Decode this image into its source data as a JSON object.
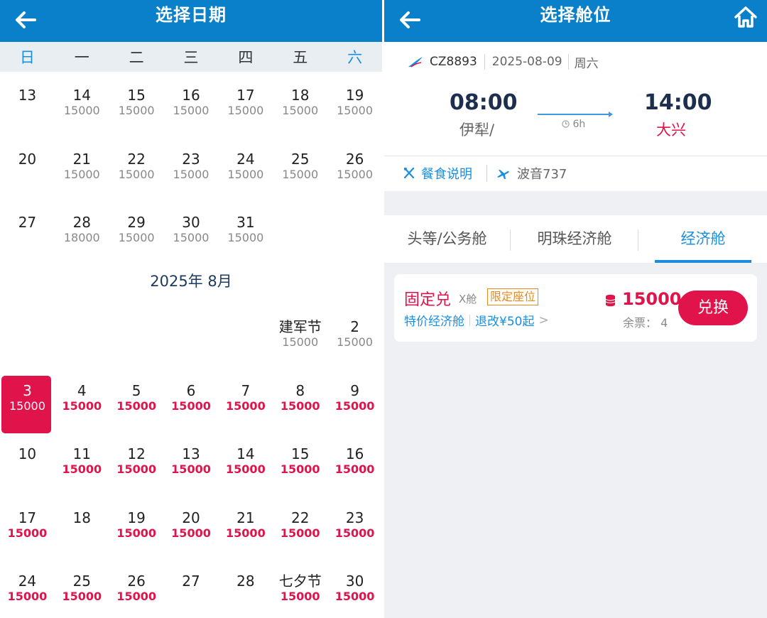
{
  "left": {
    "title": "选择日期",
    "weekdays": [
      "日",
      "一",
      "二",
      "三",
      "四",
      "五",
      "六"
    ],
    "july_rows": [
      [
        {
          "d": "13",
          "p": ""
        },
        {
          "d": "14",
          "p": "15000"
        },
        {
          "d": "15",
          "p": "15000"
        },
        {
          "d": "16",
          "p": "15000"
        },
        {
          "d": "17",
          "p": "15000"
        },
        {
          "d": "18",
          "p": "15000"
        },
        {
          "d": "19",
          "p": "15000"
        }
      ],
      [
        {
          "d": "20",
          "p": ""
        },
        {
          "d": "21",
          "p": "15000"
        },
        {
          "d": "22",
          "p": "15000"
        },
        {
          "d": "23",
          "p": "15000"
        },
        {
          "d": "24",
          "p": "15000"
        },
        {
          "d": "25",
          "p": "15000"
        },
        {
          "d": "26",
          "p": "15000"
        }
      ],
      [
        {
          "d": "27",
          "p": ""
        },
        {
          "d": "28",
          "p": "18000"
        },
        {
          "d": "29",
          "p": "15000"
        },
        {
          "d": "30",
          "p": "15000"
        },
        {
          "d": "31",
          "p": "15000"
        },
        {
          "d": "",
          "p": ""
        },
        {
          "d": "",
          "p": ""
        }
      ]
    ],
    "month_label": "2025年 8月",
    "aug_rows": [
      [
        {
          "d": "",
          "p": ""
        },
        {
          "d": "",
          "p": ""
        },
        {
          "d": "",
          "p": ""
        },
        {
          "d": "",
          "p": ""
        },
        {
          "d": "",
          "p": ""
        },
        {
          "d": "建军节",
          "p": "15000"
        },
        {
          "d": "2",
          "p": "15000"
        }
      ],
      [
        {
          "d": "3",
          "p": "15000",
          "sel": true
        },
        {
          "d": "4",
          "p": "15000",
          "red": true
        },
        {
          "d": "5",
          "p": "15000",
          "red": true
        },
        {
          "d": "6",
          "p": "15000",
          "red": true
        },
        {
          "d": "7",
          "p": "15000",
          "red": true
        },
        {
          "d": "8",
          "p": "15000",
          "red": true
        },
        {
          "d": "9",
          "p": "15000",
          "red": true
        }
      ],
      [
        {
          "d": "10",
          "p": ""
        },
        {
          "d": "11",
          "p": "15000",
          "red": true
        },
        {
          "d": "12",
          "p": "15000",
          "red": true
        },
        {
          "d": "13",
          "p": "15000",
          "red": true
        },
        {
          "d": "14",
          "p": "15000",
          "red": true
        },
        {
          "d": "15",
          "p": "15000",
          "red": true
        },
        {
          "d": "16",
          "p": "15000",
          "red": true
        }
      ],
      [
        {
          "d": "17",
          "p": "15000",
          "red": true
        },
        {
          "d": "18",
          "p": ""
        },
        {
          "d": "19",
          "p": "15000",
          "red": true
        },
        {
          "d": "20",
          "p": "15000",
          "red": true
        },
        {
          "d": "21",
          "p": "15000",
          "red": true
        },
        {
          "d": "22",
          "p": "15000",
          "red": true
        },
        {
          "d": "23",
          "p": "15000",
          "red": true
        }
      ],
      [
        {
          "d": "24",
          "p": "15000",
          "red": true
        },
        {
          "d": "25",
          "p": "15000",
          "red": true
        },
        {
          "d": "26",
          "p": "15000",
          "red": true
        },
        {
          "d": "27",
          "p": ""
        },
        {
          "d": "28",
          "p": ""
        },
        {
          "d": "七夕节",
          "p": "15000",
          "red": true
        },
        {
          "d": "30",
          "p": "15000",
          "red": true
        }
      ]
    ]
  },
  "right": {
    "title": "选择舱位",
    "flight_no": "CZ8893",
    "date": "2025-08-09",
    "weekday": "周六",
    "dep_time": "08:00",
    "dep_city": "伊犁/",
    "arr_time": "14:00",
    "arr_city": "大兴",
    "duration": "6h",
    "meal_label": "餐食说明",
    "plane": "波音737",
    "tabs": [
      "头等/公务舱",
      "明珠经济舱",
      "经济舱"
    ],
    "card": {
      "name": "固定兑",
      "cabin": "X舱",
      "tag": "限定座位",
      "sub1": "特价经济舱",
      "sub2": "退改¥50起",
      "sub_arrow": ">",
      "price": "15000",
      "remain": "余票： 4",
      "button": "兑换"
    }
  },
  "colors": {
    "brand_blue": "#0a7fca",
    "accent_red": "#e0134b",
    "link_blue": "#1a8ee0",
    "tag_orange": "#e88a1a"
  }
}
